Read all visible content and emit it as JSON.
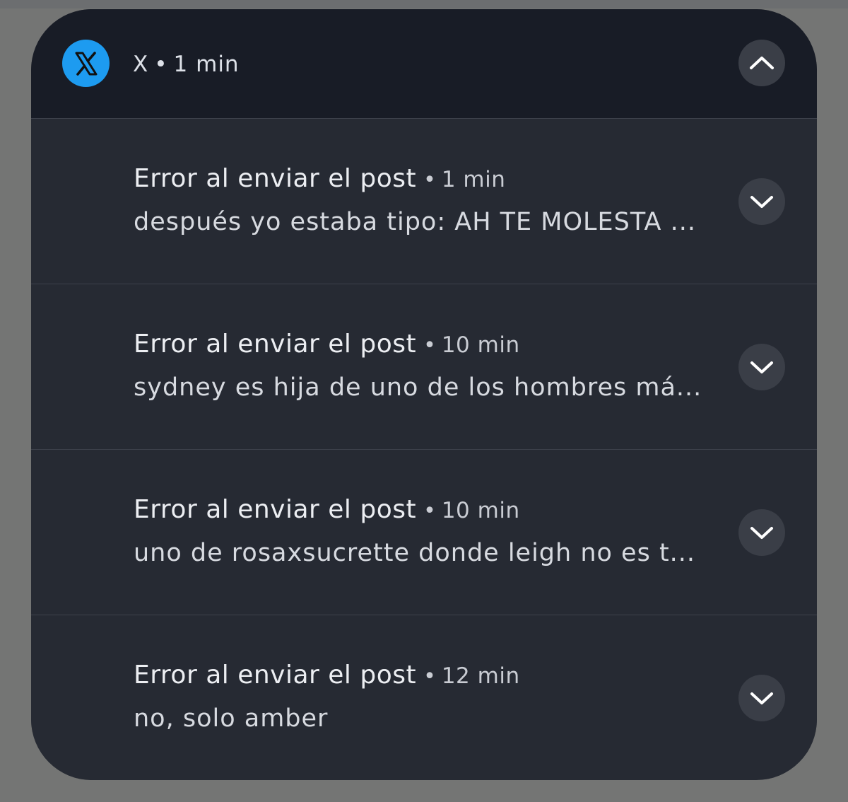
{
  "app": {
    "icon": "x-logo-icon",
    "name": "X",
    "separator": "•",
    "time": "1 min",
    "collapse_icon": "chevron-up-icon"
  },
  "colors": {
    "icon_bg": "#1d9bf0",
    "header_bg": "#181c26",
    "panel_bg": "#262a33",
    "button_bg": "#3a3e47"
  },
  "notifications": [
    {
      "title": "Error al enviar el post",
      "separator": "•",
      "time": "1 min",
      "body": "después yo estaba tipo: AH TE MOLESTA ...",
      "expand_icon": "chevron-down-icon"
    },
    {
      "title": "Error al enviar el post",
      "separator": "•",
      "time": "10 min",
      "body": "sydney es hija de uno de los hombres má...",
      "expand_icon": "chevron-down-icon"
    },
    {
      "title": "Error al enviar el post",
      "separator": "•",
      "time": "10 min",
      "body": "uno de rosaxsucrette donde leigh no es t...",
      "expand_icon": "chevron-down-icon"
    },
    {
      "title": "Error al enviar el post",
      "separator": "•",
      "time": "12 min",
      "body": "no, solo amber",
      "expand_icon": "chevron-down-icon"
    }
  ]
}
